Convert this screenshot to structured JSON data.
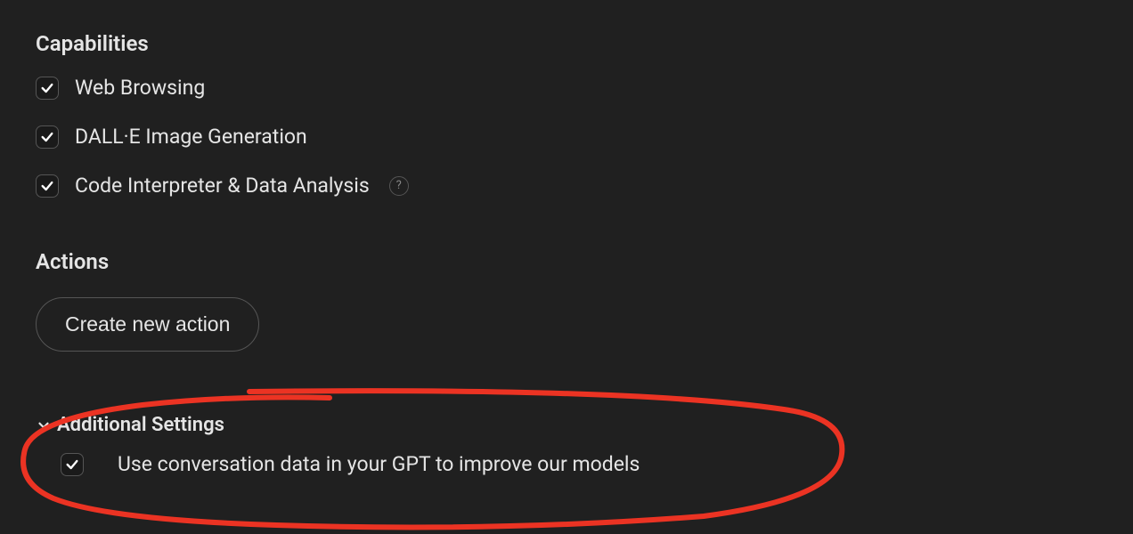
{
  "capabilities": {
    "header": "Capabilities",
    "items": [
      {
        "label": "Web Browsing",
        "checked": true,
        "help": false
      },
      {
        "label": "DALL·E Image Generation",
        "checked": true,
        "help": false
      },
      {
        "label": "Code Interpreter & Data Analysis",
        "checked": true,
        "help": true
      }
    ]
  },
  "actions": {
    "header": "Actions",
    "create_button": "Create new action"
  },
  "additional": {
    "header": "Additional Settings",
    "items": [
      {
        "label": "Use conversation data in your GPT to improve our models",
        "checked": true
      }
    ]
  },
  "help_glyph": "?"
}
